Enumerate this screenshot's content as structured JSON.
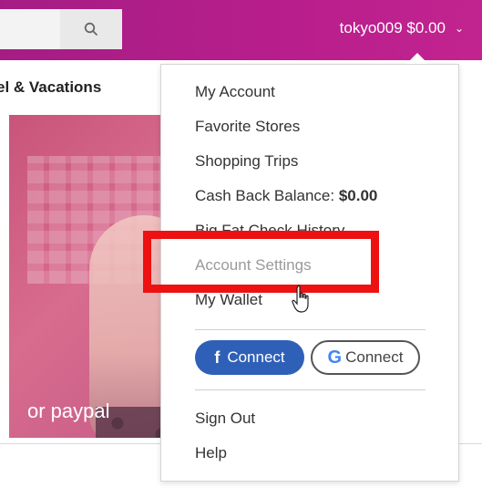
{
  "header": {
    "search_icon": "search-icon",
    "account_label": "tokyo009 $0.00",
    "chevron_icon": "chevron-down-icon"
  },
  "subnav": {
    "item": "el & Vacations"
  },
  "hero": {
    "text": "or paypal"
  },
  "dropdown": {
    "items": [
      {
        "label": "My Account"
      },
      {
        "label": "Favorite Stores"
      },
      {
        "label": "Shopping Trips"
      },
      {
        "label": "Cash Back Balance: ",
        "value": "$0.00"
      },
      {
        "label": "Big Fat Check History"
      },
      {
        "label": "Account Settings"
      },
      {
        "label": "My Wallet"
      }
    ],
    "facebook_connect": "Connect",
    "google_connect": "Connect",
    "sign_out": "Sign Out",
    "help": "Help"
  },
  "colors": {
    "brand_purple": "#b81e8c",
    "facebook_blue": "#2f60b8",
    "highlight_red": "#ee1111"
  }
}
